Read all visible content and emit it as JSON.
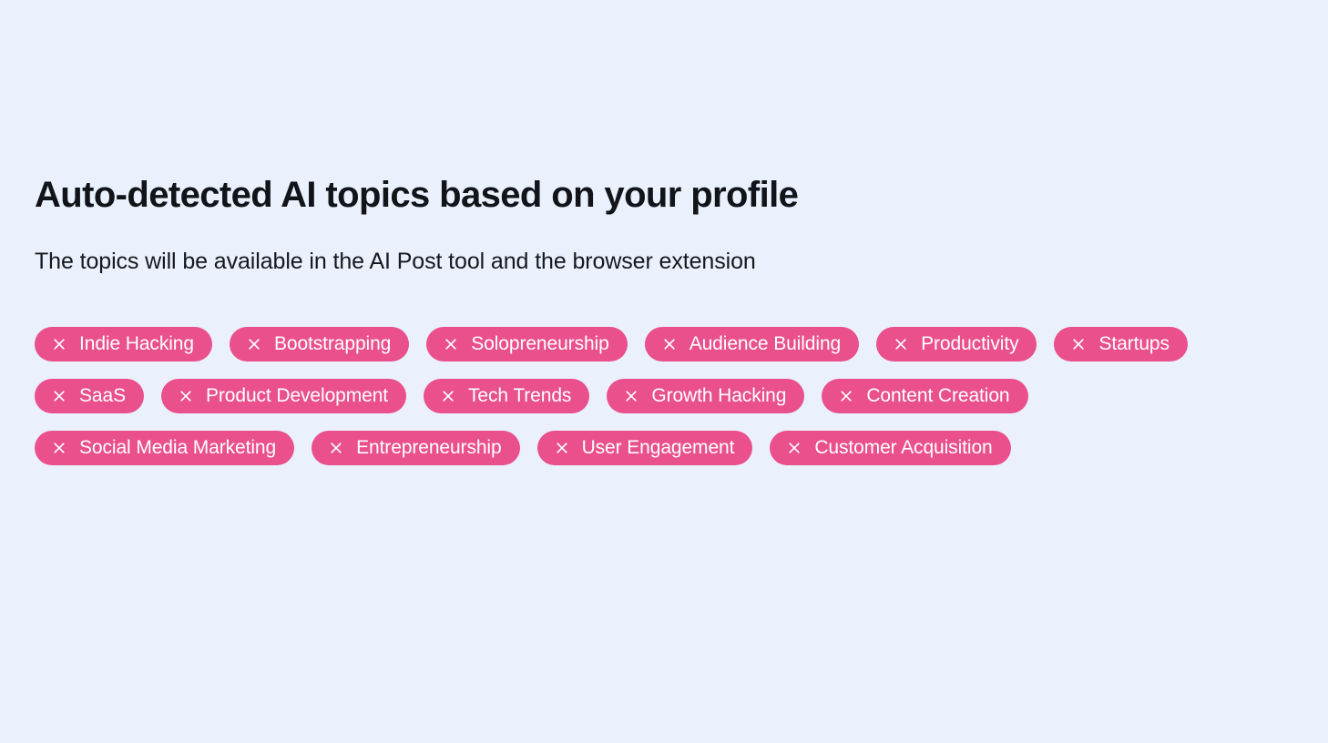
{
  "theme": {
    "background": "#eaf1fd",
    "chip_background": "#e9508c",
    "chip_text": "#ffffff",
    "title_color": "#111418",
    "subtitle_color": "#15181c"
  },
  "header": {
    "title": "Auto-detected AI topics based on your profile",
    "subtitle": "The topics will be available in the AI Post tool and the browser extension"
  },
  "topics": {
    "remove_icon": "close-icon",
    "items": [
      {
        "label": "Indie Hacking"
      },
      {
        "label": "Bootstrapping"
      },
      {
        "label": "Solopreneurship"
      },
      {
        "label": "Audience Building"
      },
      {
        "label": "Productivity"
      },
      {
        "label": "Startups"
      },
      {
        "label": "SaaS"
      },
      {
        "label": "Product Development"
      },
      {
        "label": "Tech Trends"
      },
      {
        "label": "Growth Hacking"
      },
      {
        "label": "Content Creation"
      },
      {
        "label": "Social Media Marketing"
      },
      {
        "label": "Entrepreneurship"
      },
      {
        "label": "User Engagement"
      },
      {
        "label": "Customer Acquisition"
      }
    ]
  }
}
